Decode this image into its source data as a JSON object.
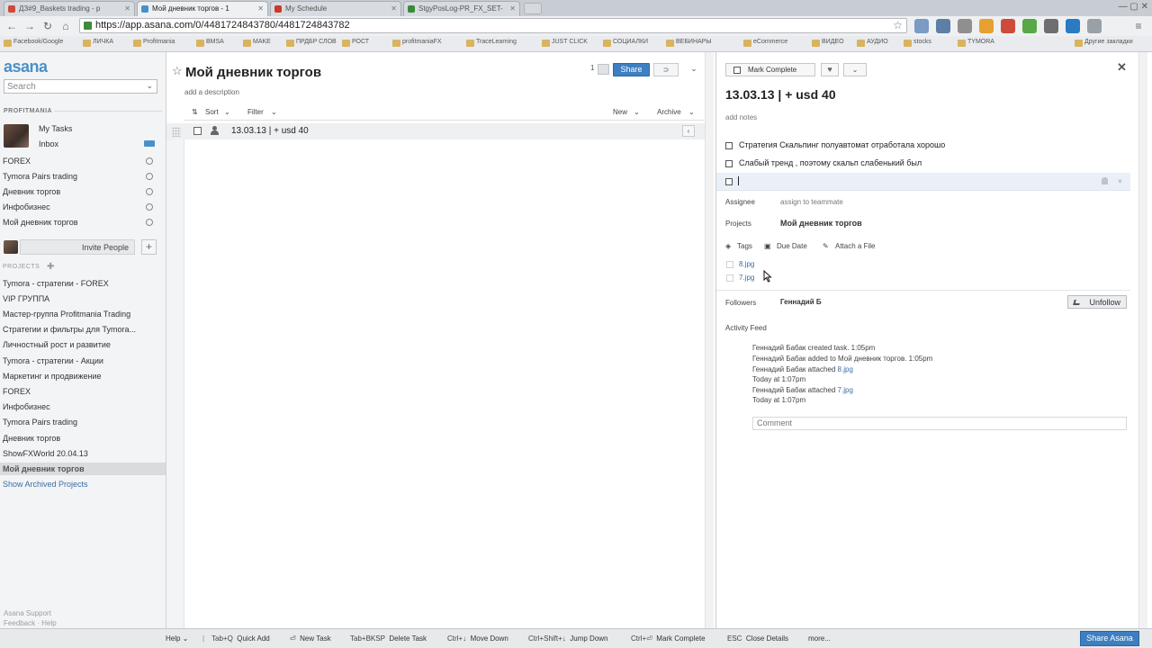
{
  "browser": {
    "tabs": [
      {
        "label": "ДЗ#9_Baskets trading - p",
        "active": false,
        "favicon_color": "#d04a3a"
      },
      {
        "label": "Мой дневник торгов - 1",
        "active": true,
        "favicon_color": "#4a90c8"
      },
      {
        "label": "My Schedule",
        "active": false,
        "favicon_color": "#c83a2a"
      },
      {
        "label": "StgyPosLog-PR_FX_SET-",
        "active": false,
        "favicon_color": "#3a8a3a"
      }
    ],
    "url": "https://app.asana.com/0/4481724843780/4481724843782",
    "bookmarks": [
      "Facebook/Google",
      "ЛИЧКА",
      "Profitmania",
      "BMSA",
      "MAKE",
      "ПРДБР СЛОВ",
      "РОСТ",
      "profitmaniaFX",
      "TraceLearning",
      "JUST CLICK",
      "СОЦИАЛКИ",
      "ВЕБИНАРЫ",
      "eCommerce",
      "ВИДЕО",
      "АУДИО",
      "stocks",
      "TYMORA",
      "Другие закладки"
    ]
  },
  "sidebar": {
    "logo": "asana",
    "search_placeholder": "Search",
    "workspace": "PROFITMANIA",
    "my_tasks": "My Tasks",
    "inbox": "Inbox",
    "tags": [
      "FOREX",
      "Tymora Pairs trading",
      "Дневник торгов",
      "Инфобизнес",
      "Мой дневник торгов"
    ],
    "invite_label": "Invite People",
    "invite_plus": "+",
    "projects_header": "PROJECTS",
    "projects": [
      "Tymora - стратегии - FOREX",
      "VIP ГРУППА",
      "Мастер-группа Profitmania Trading",
      "Стратегии и фильтры для Tymora...",
      "Личностный рост и развитие",
      "Tymora - стратегии - Акции",
      "Маркетинг и продвижение",
      "FOREX",
      "Инфобизнес",
      "Tymora Pairs trading",
      "Дневник торгов",
      "ShowFXWorld 20.04.13",
      "Мой дневник торгов"
    ],
    "selected_project": "Мой дневник торгов",
    "show_archived": "Show Archived Projects",
    "bottom_links": [
      "Asana Support",
      "Feedback",
      "Help"
    ]
  },
  "project": {
    "title": "Мой дневник торгов",
    "description_placeholder": "add a description",
    "share_count": "1",
    "share_label": "Share",
    "toolbar": {
      "sort": "Sort",
      "filter": "Filter",
      "new": "New",
      "archive": "Archive"
    },
    "tasks": [
      {
        "name": "13.03.13 | + usd 40"
      }
    ]
  },
  "details": {
    "mark_complete": "Mark Complete",
    "title": "13.03.13 | + usd 40",
    "notes_placeholder": "add notes",
    "subtasks": [
      "Стратегия Скальпинг полуавтомат отработала хорошо",
      "Слабый тренд , поэтому скальп слабенький был"
    ],
    "assignee_label": "Assignee",
    "assignee_value": "assign to teammate",
    "projects_label": "Projects",
    "projects_value": "Мой дневник торгов",
    "tags_label": "Tags",
    "due_date_label": "Due Date",
    "attach_label": "Attach a File",
    "attachments": [
      "8.jpg",
      "7.jpg"
    ],
    "followers_label": "Followers",
    "followers_value": "Геннадий Б",
    "unfollow_label": "Unfollow",
    "activity_label": "Activity Feed",
    "activity": [
      {
        "text": "Геннадий Бабак created task.   1:05pm"
      },
      {
        "text": "Геннадий Бабак added to Мой дневник торгов.   1:05pm"
      },
      {
        "text": "Геннадий Бабак attached ",
        "link": "8.jpg"
      },
      {
        "text": "Today at 1:07pm"
      },
      {
        "text": "Геннадий Бабак attached ",
        "link": "7.jpg"
      },
      {
        "text": "Today at 1:07pm"
      }
    ],
    "comment_placeholder": "Comment"
  },
  "footer": {
    "help": "Help",
    "shortcuts": [
      {
        "key": "Tab+Q",
        "action": "Quick Add"
      },
      {
        "key": "⏎",
        "action": "New Task"
      },
      {
        "key": "Tab+BKSP",
        "action": "Delete Task"
      },
      {
        "key": "Ctrl+↓",
        "action": "Move Down"
      },
      {
        "key": "Ctrl+Shift+↓",
        "action": "Jump Down"
      },
      {
        "key": "Ctrl+⏎",
        "action": "Mark Complete"
      },
      {
        "key": "ESC",
        "action": "Close Details"
      }
    ],
    "more": "more...",
    "share_asana": "Share Asana"
  }
}
